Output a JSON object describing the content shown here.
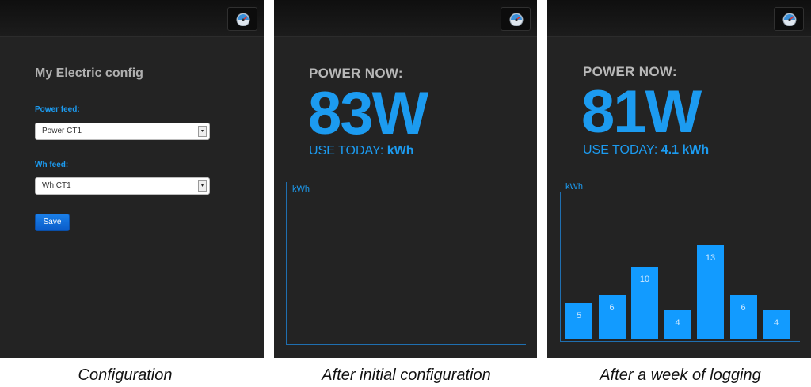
{
  "config_panel": {
    "title": "My Electric config",
    "power_feed_label": "Power feed:",
    "power_feed_value": "Power CT1",
    "wh_feed_label": "Wh feed:",
    "wh_feed_value": "Wh CT1",
    "save_label": "Save"
  },
  "initial_panel": {
    "power_now_label": "POWER NOW:",
    "power_value": "83W",
    "use_today_label": "USE TODAY:",
    "use_today_value": "kWh",
    "chart_ylabel": "kWh"
  },
  "week_panel": {
    "power_now_label": "POWER NOW:",
    "power_value": "81W",
    "use_today_label": "USE TODAY:",
    "use_today_value": "4.1 kWh",
    "chart_ylabel": "kWh"
  },
  "chart_data": {
    "type": "bar",
    "ylabel": "kWh",
    "values": [
      5,
      6,
      10,
      4,
      13,
      6,
      4
    ],
    "labels": [
      "5",
      "6",
      "10",
      "4",
      "13",
      "6",
      "4"
    ]
  },
  "captions": {
    "config": "Configuration",
    "initial": "After initial configuration",
    "week": "After a week of logging"
  },
  "colors": {
    "accent": "#1c9bf0",
    "bar": "#129bff",
    "panel_bg": "#232323"
  }
}
